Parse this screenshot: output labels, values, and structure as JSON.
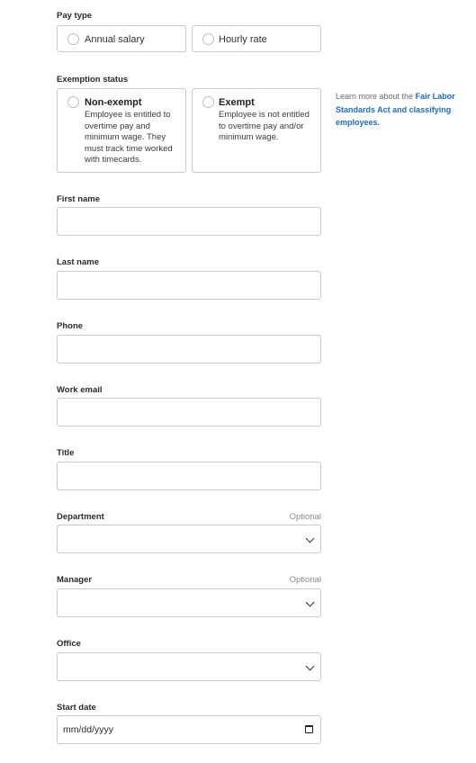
{
  "pay_type": {
    "label": "Pay type",
    "options": [
      {
        "label": "Annual salary"
      },
      {
        "label": "Hourly rate"
      }
    ]
  },
  "exemption": {
    "label": "Exemption status",
    "options": [
      {
        "title": "Non-exempt",
        "description": "Employee is entitled to overtime pay and minimum wage. They must track time worked with timecards."
      },
      {
        "title": "Exempt",
        "description": "Employee is not entitled to overtime pay and/or minimum wage."
      }
    ],
    "help_prefix": "Learn more about the",
    "help_link": "Fair Labor Standards Act and classifying employees."
  },
  "fields": {
    "first_name": {
      "label": "First name"
    },
    "last_name": {
      "label": "Last name"
    },
    "phone": {
      "label": "Phone"
    },
    "work_email": {
      "label": "Work email"
    },
    "title": {
      "label": "Title"
    },
    "department": {
      "label": "Department",
      "optional": "Optional"
    },
    "manager": {
      "label": "Manager",
      "optional": "Optional"
    },
    "office": {
      "label": "Office"
    },
    "start_date": {
      "label": "Start date",
      "placeholder": "mm/dd/yyyy"
    }
  },
  "colors": {
    "link": "#1a6dc9",
    "border": "#c9c9c9"
  }
}
